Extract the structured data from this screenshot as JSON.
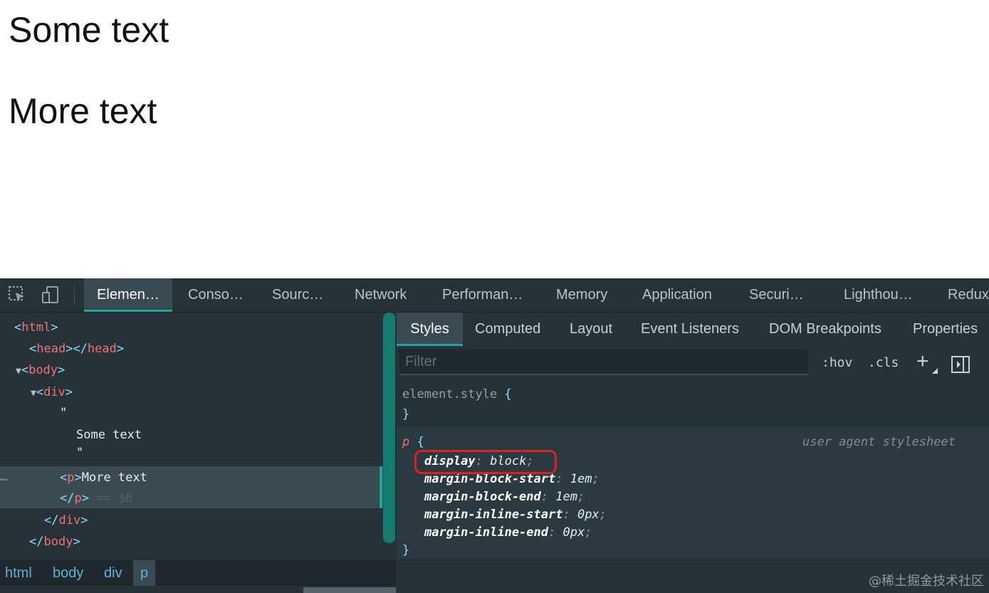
{
  "page": {
    "text1": "Some text",
    "text2": "More text"
  },
  "devtools": {
    "tools": {
      "inspect_icon": "inspect-element-icon",
      "device_icon": "device-toolbar-icon"
    },
    "main_tabs": [
      {
        "label": "Elemen…",
        "active": true
      },
      {
        "label": "Conso…"
      },
      {
        "label": "Sourc…"
      },
      {
        "label": "Network"
      },
      {
        "label": "Performan…"
      },
      {
        "label": "Memory"
      },
      {
        "label": "Application"
      },
      {
        "label": "Securi…"
      },
      {
        "label": "Lighthou…"
      },
      {
        "label": "Redux"
      }
    ],
    "dom": {
      "html_tag": "html",
      "head_tag": "head",
      "body_tag": "body",
      "div_tag": "div",
      "quote_open": "\"",
      "text_node": "Some text",
      "quote_close": "\"",
      "p_tag": "p",
      "p_text": "More text",
      "selected_hint": "== $0",
      "ellipsis": "…"
    },
    "breadcrumb": [
      "html",
      "body",
      "div",
      "p"
    ],
    "styles_tabs": [
      {
        "label": "Styles",
        "active": true
      },
      {
        "label": "Computed"
      },
      {
        "label": "Layout"
      },
      {
        "label": "Event Listeners"
      },
      {
        "label": "DOM Breakpoints"
      },
      {
        "label": "Properties"
      }
    ],
    "filter": {
      "placeholder": "Filter",
      "hov": ":hov",
      "cls": ".cls",
      "plus": "+"
    },
    "rules": {
      "element_style_selector": "element.style",
      "open_brace": "{",
      "close_brace": "}",
      "p_selector": "p",
      "source": "user agent stylesheet",
      "declarations": [
        {
          "prop": "display",
          "value": "block"
        },
        {
          "prop": "margin-block-start",
          "value": "1em"
        },
        {
          "prop": "margin-block-end",
          "value": "1em"
        },
        {
          "prop": "margin-inline-start",
          "value": "0px"
        },
        {
          "prop": "margin-inline-end",
          "value": "0px"
        }
      ]
    },
    "colors": {
      "accent": "#21a69a",
      "tag": "#f07178",
      "highlight": "#e0201c"
    }
  },
  "watermark": "@稀土掘金技术社区"
}
